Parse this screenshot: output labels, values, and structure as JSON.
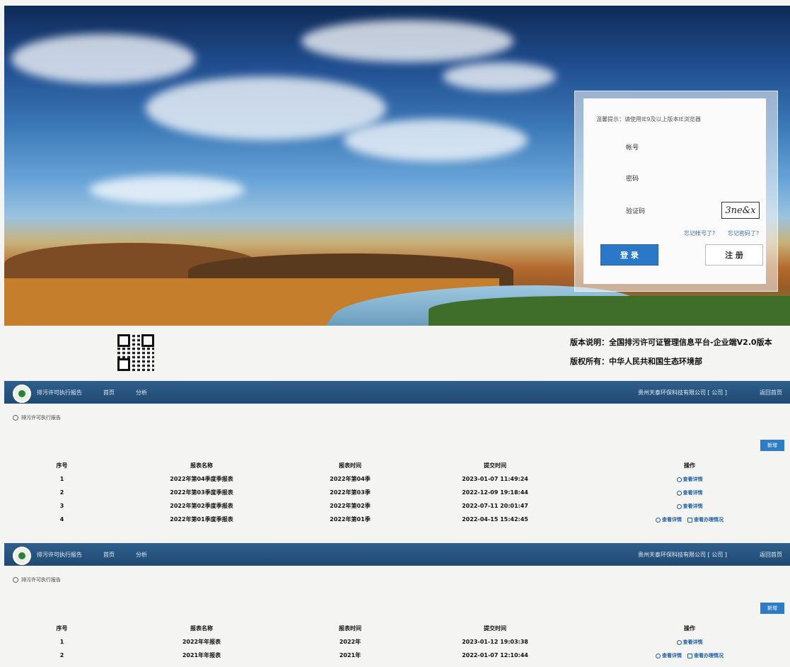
{
  "login": {
    "notice": "温馨提示：请使用IE9及以上版本IE浏览器",
    "account_label": "帐号",
    "password_label": "密码",
    "captcha_label": "验证码",
    "captcha_text": "3ne&x",
    "forgot_account": "忘记帐号了?",
    "forgot_password": "忘记密码了?",
    "login_button": "登 录",
    "register_button": "注 册"
  },
  "footer": {
    "version": "版本说明：全国排污许可证管理信息平台-企业端V2.0版本",
    "copyright": "版权所有：中华人民共和国生态环境部"
  },
  "navbar": {
    "title": "排污许可执行报告",
    "menu_1": "首页",
    "menu_2": "分析",
    "company": "贵州天泰环保科技有限公司 [ 公司 ]",
    "back": "返回首页"
  },
  "section1": {
    "breadcrumb": "排污许可执行报告",
    "new_button": "新增",
    "headers": [
      "序号",
      "报表名称",
      "报表时间",
      "提交时间",
      "操作"
    ],
    "rows": [
      {
        "no": "1",
        "name": "2022年第04季度季报表",
        "period": "2022年第04季",
        "submitted": "2023-01-07 11:49:24",
        "op1": "查看详情",
        "op2": ""
      },
      {
        "no": "2",
        "name": "2022年第03季度季报表",
        "period": "2022年第03季",
        "submitted": "2022-12-09 19:18:44",
        "op1": "查看详情",
        "op2": ""
      },
      {
        "no": "3",
        "name": "2022年第02季度季报表",
        "period": "2022年第02季",
        "submitted": "2022-07-11 20:01:47",
        "op1": "查看详情",
        "op2": ""
      },
      {
        "no": "4",
        "name": "2022年第01季度季报表",
        "period": "2022年第01季",
        "submitted": "2022-04-15 15:42:45",
        "op1": "查看详情",
        "op2": "查看办理情况"
      }
    ]
  },
  "section2": {
    "breadcrumb": "排污许可执行报告",
    "new_button": "新增",
    "headers": [
      "序号",
      "报表名称",
      "报表时间",
      "提交时间",
      "操作"
    ],
    "rows": [
      {
        "no": "1",
        "name": "2022年年报表",
        "period": "2022年",
        "submitted": "2023-01-12 19:03:38",
        "op1": "查看详情",
        "op2": ""
      },
      {
        "no": "2",
        "name": "2021年年报表",
        "period": "2021年",
        "submitted": "2022-01-07 12:10:44",
        "op1": "查看详情",
        "op2": "查看办理情况"
      }
    ]
  },
  "colors": {
    "navbar": "#1f4a72",
    "primary_button": "#2b78c8",
    "link": "#1d5fa6"
  }
}
